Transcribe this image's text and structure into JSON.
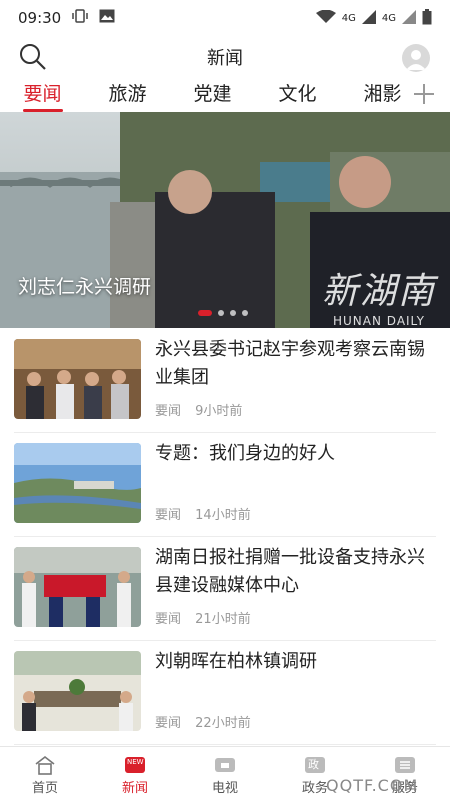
{
  "status_bar": {
    "time": "09:30",
    "network_label_1": "4G",
    "network_label_2": "4G"
  },
  "header": {
    "title": "新闻"
  },
  "tabs": [
    {
      "label": "要闻",
      "active": true
    },
    {
      "label": "旅游",
      "active": false
    },
    {
      "label": "党建",
      "active": false
    },
    {
      "label": "文化",
      "active": false
    },
    {
      "label": "湘影",
      "active": false
    }
  ],
  "hero": {
    "caption": "刘志仁永兴调研",
    "watermark_cn": "新湖南",
    "watermark_en": "HUNAN DAILY",
    "slide_count": 4,
    "active_slide": 1
  },
  "news": [
    {
      "title": "永兴县委书记赵宇参观考察云南锡业集团",
      "category": "要闻",
      "time": "9小时前"
    },
    {
      "title": "专题：我们身边的好人",
      "category": "要闻",
      "time": "14小时前"
    },
    {
      "title": "湖南日报社捐赠一批设备支持永兴县建设融媒体中心",
      "category": "要闻",
      "time": "21小时前"
    },
    {
      "title": "刘朝晖在柏林镇调研",
      "category": "要闻",
      "time": "22小时前"
    }
  ],
  "bottom_nav": [
    {
      "label": "首页",
      "icon": "home-icon",
      "active": false
    },
    {
      "label": "新闻",
      "icon": "news-icon",
      "badge": "NEW",
      "active": true
    },
    {
      "label": "电视",
      "icon": "tv-icon",
      "active": false
    },
    {
      "label": "政务",
      "icon": "government-icon",
      "badge_char": "政",
      "active": false
    },
    {
      "label": "服务",
      "icon": "service-icon",
      "active": false
    }
  ],
  "footer_watermark": "QQTF.COM",
  "colors": {
    "accent": "#d9202b",
    "text": "#222222",
    "meta": "#999999"
  }
}
